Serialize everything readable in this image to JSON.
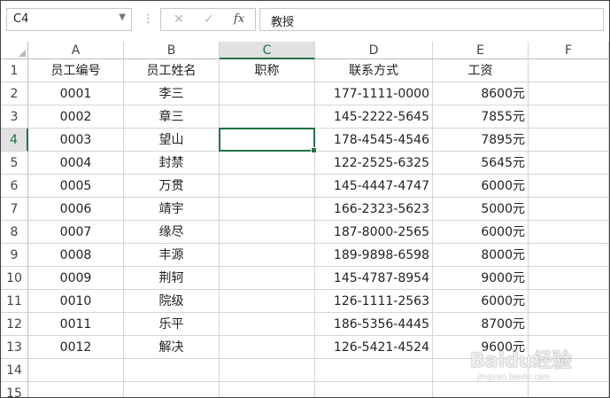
{
  "formula_bar": {
    "name_box": "C4",
    "separator": "⋮",
    "cancel_glyph": "✕",
    "enter_glyph": "✓",
    "fx_glyph": "fx",
    "formula": "教授"
  },
  "columns": [
    "A",
    "B",
    "C",
    "D",
    "E",
    "F"
  ],
  "selected_column": "C",
  "rows": [
    "1",
    "2",
    "3",
    "4",
    "5",
    "6",
    "7",
    "8",
    "9",
    "10",
    "11",
    "12",
    "13",
    "14",
    "15"
  ],
  "selected_row": "4",
  "header": {
    "a": "员工编号",
    "b": "员工姓名",
    "c": "职称",
    "d": "联系方式",
    "e": "工资"
  },
  "records": [
    {
      "a": "0001",
      "b": "李三",
      "c": "",
      "d": "177-1111-0000",
      "e": "8600元"
    },
    {
      "a": "0002",
      "b": "章三",
      "c": "",
      "d": "145-2222-5645",
      "e": "7855元"
    },
    {
      "a": "0003",
      "b": "望山",
      "c": "",
      "d": "178-4545-4546",
      "e": "7895元"
    },
    {
      "a": "0004",
      "b": "封禁",
      "c": "",
      "d": "122-2525-6325",
      "e": "5645元"
    },
    {
      "a": "0005",
      "b": "万贯",
      "c": "",
      "d": "145-4447-4747",
      "e": "6000元"
    },
    {
      "a": "0006",
      "b": "靖宇",
      "c": "",
      "d": "166-2323-5623",
      "e": "5000元"
    },
    {
      "a": "0007",
      "b": "缘尽",
      "c": "",
      "d": "187-8000-2565",
      "e": "6000元"
    },
    {
      "a": "0008",
      "b": "丰源",
      "c": "",
      "d": "189-9898-6598",
      "e": "8000元"
    },
    {
      "a": "0009",
      "b": "荆轲",
      "c": "",
      "d": "145-4787-8954",
      "e": "9000元"
    },
    {
      "a": "0010",
      "b": "院级",
      "c": "",
      "d": "126-1111-2563",
      "e": "6000元"
    },
    {
      "a": "0011",
      "b": "乐平",
      "c": "",
      "d": "186-5356-4445",
      "e": "8700元"
    },
    {
      "a": "0012",
      "b": "解决",
      "c": "",
      "d": "126-5421-4524",
      "e": "9600元"
    }
  ],
  "watermark": {
    "brand": "Baidu经验",
    "url": "jingyan.baidu.com"
  },
  "colors": {
    "accent": "#217346",
    "header_sel_bg": "#e1e1e1",
    "gridline": "#d4d4d4"
  }
}
